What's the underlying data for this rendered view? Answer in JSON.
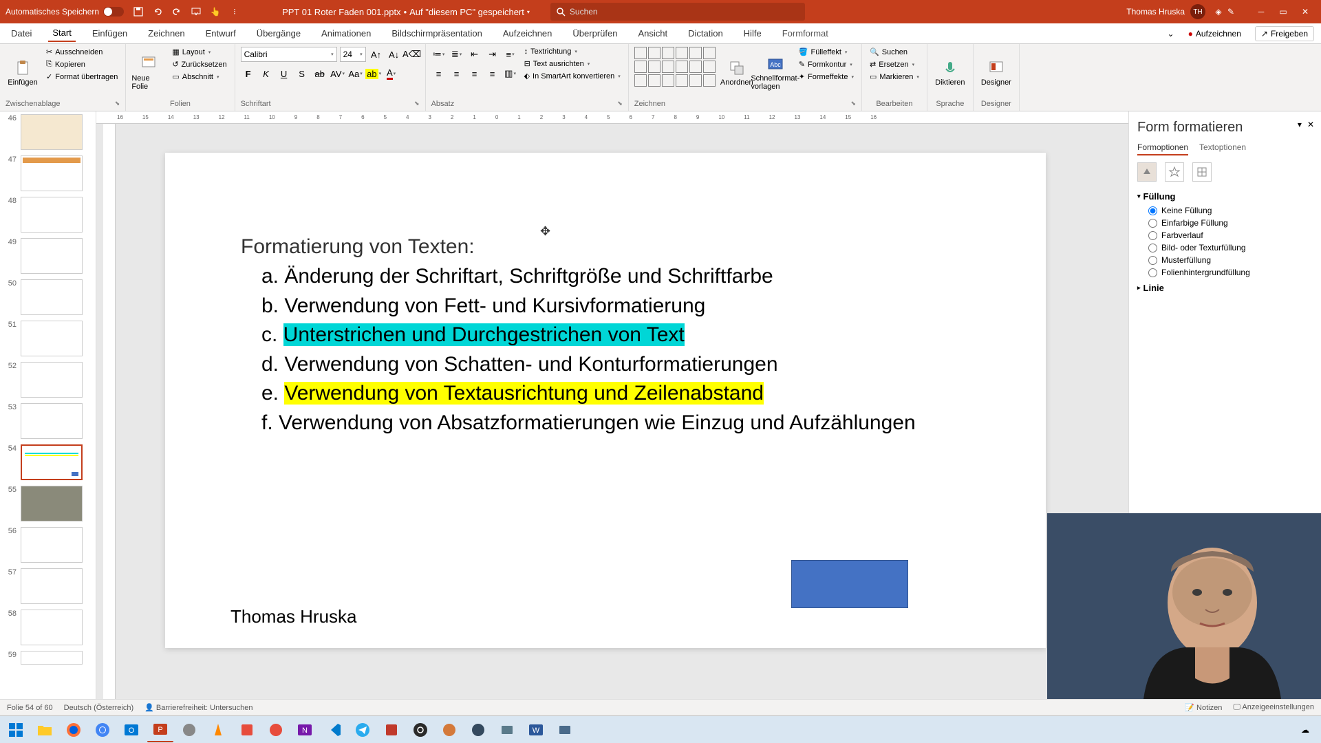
{
  "titlebar": {
    "autosave_label": "Automatisches Speichern",
    "filename": "PPT 01 Roter Faden 001.pptx",
    "save_loc": "Auf \"diesem PC\" gespeichert",
    "search_placeholder": "Suchen",
    "user_name": "Thomas Hruska",
    "user_initials": "TH"
  },
  "tabs": {
    "datei": "Datei",
    "start": "Start",
    "einfuegen": "Einfügen",
    "zeichnen": "Zeichnen",
    "entwurf": "Entwurf",
    "uebergaenge": "Übergänge",
    "animationen": "Animationen",
    "bildschirm": "Bildschirmpräsentation",
    "aufzeichnen": "Aufzeichnen",
    "ueberpruefen": "Überprüfen",
    "ansicht": "Ansicht",
    "dictation": "Dictation",
    "hilfe": "Hilfe",
    "formformat": "Formformat",
    "rec_btn": "Aufzeichnen",
    "share_btn": "Freigeben"
  },
  "ribbon": {
    "clipboard": {
      "paste": "Einfügen",
      "cut": "Ausschneiden",
      "copy": "Kopieren",
      "format_painter": "Format übertragen",
      "label": "Zwischenablage"
    },
    "slides": {
      "new_slide": "Neue Folie",
      "layout": "Layout",
      "reset": "Zurücksetzen",
      "section": "Abschnitt",
      "label": "Folien"
    },
    "font": {
      "name": "Calibri",
      "size": "24",
      "label": "Schriftart"
    },
    "paragraph": {
      "textdir": "Textrichtung",
      "align_text": "Text ausrichten",
      "smartart": "In SmartArt konvertieren",
      "label": "Absatz"
    },
    "drawing": {
      "arrange": "Anordnen",
      "quick_styles": "Schnellformat-vorlagen",
      "fill": "Fülleffekt",
      "outline": "Formkontur",
      "effects": "Formeffekte",
      "label": "Zeichnen"
    },
    "editing": {
      "find": "Suchen",
      "replace": "Ersetzen",
      "select": "Markieren",
      "label": "Bearbeiten"
    },
    "voice": {
      "dictate": "Diktieren",
      "label": "Sprache"
    },
    "designer": {
      "btn": "Designer",
      "label": "Designer"
    }
  },
  "thumbs": {
    "n46": "46",
    "n47": "47",
    "n48": "48",
    "n49": "49",
    "n50": "50",
    "n51": "51",
    "n52": "52",
    "n53": "53",
    "n54": "54",
    "n55": "55",
    "n56": "56",
    "n57": "57",
    "n58": "58",
    "n59": "59"
  },
  "slide": {
    "title": "Formatierung von Texten:",
    "item_a": "a. Änderung der Schriftart, Schriftgröße und Schriftfarbe",
    "item_b": "b. Verwendung von Fett- und Kursivformatierung",
    "item_c_prefix": "c. ",
    "item_c": "Unterstrichen und Durchgestrichen von Text",
    "item_d": "d. Verwendung von Schatten- und Konturformatierungen",
    "item_e_prefix": "e. ",
    "item_e": "Verwendung von Textausrichtung und Zeilenabstand",
    "item_f": "f. Verwendung von Absatzformatierungen wie Einzug und Aufzählungen",
    "footer": "Thomas Hruska"
  },
  "pane": {
    "title": "Form formatieren",
    "tab_form": "Formoptionen",
    "tab_text": "Textoptionen",
    "fill_hdr": "Füllung",
    "fill_none": "Keine Füllung",
    "fill_solid": "Einfarbige Füllung",
    "fill_gradient": "Farbverlauf",
    "fill_picture": "Bild- oder Texturfüllung",
    "fill_pattern": "Musterfüllung",
    "fill_slidebg": "Folienhintergrundfüllung",
    "line_hdr": "Linie"
  },
  "status": {
    "slide_info": "Folie 54 of 60",
    "lang": "Deutsch (Österreich)",
    "access": "Barrierefreiheit: Untersuchen",
    "notes": "Notizen",
    "display": "Anzeigeeinstellungen"
  }
}
